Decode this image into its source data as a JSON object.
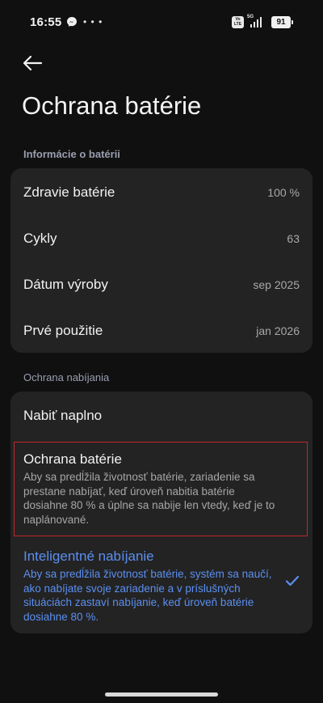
{
  "status_bar": {
    "time": "16:55",
    "dots": "• • •",
    "volte": "Vo LTE",
    "network": "5G",
    "battery": "91"
  },
  "header": {
    "title": "Ochrana batérie"
  },
  "battery_info": {
    "section_label": "Informácie o batérii",
    "rows": [
      {
        "label": "Zdravie batérie",
        "value": "100 %"
      },
      {
        "label": "Cykly",
        "value": "63"
      },
      {
        "label": "Dátum výroby",
        "value": "sep 2025"
      },
      {
        "label": "Prvé použitie",
        "value": "jan 2026"
      }
    ]
  },
  "charging_protection": {
    "section_label": "Ochrana nabíjania",
    "options": [
      {
        "title": "Nabiť naplno",
        "description": "",
        "selected": false
      },
      {
        "title": "Ochrana batérie",
        "description": "Aby sa predĺžila životnosť batérie, zariadenie sa prestane nabíjať, keď úroveň nabitia batérie dosiahne 80 % a úplne sa nabije len vtedy, keď je to naplánované.",
        "selected": false
      },
      {
        "title": "Inteligentné nabíjanie",
        "description": "Aby sa predĺžila životnosť batérie, systém sa naučí, ako nabíjate svoje zariadenie a v príslušných situáciách zastaví nabíjanie, keď úroveň batérie dosiahne 80 %.",
        "selected": true
      }
    ]
  },
  "colors": {
    "background": "#101010",
    "card": "#232323",
    "accent": "#5b8ff0",
    "highlight_border": "#c1272d"
  }
}
